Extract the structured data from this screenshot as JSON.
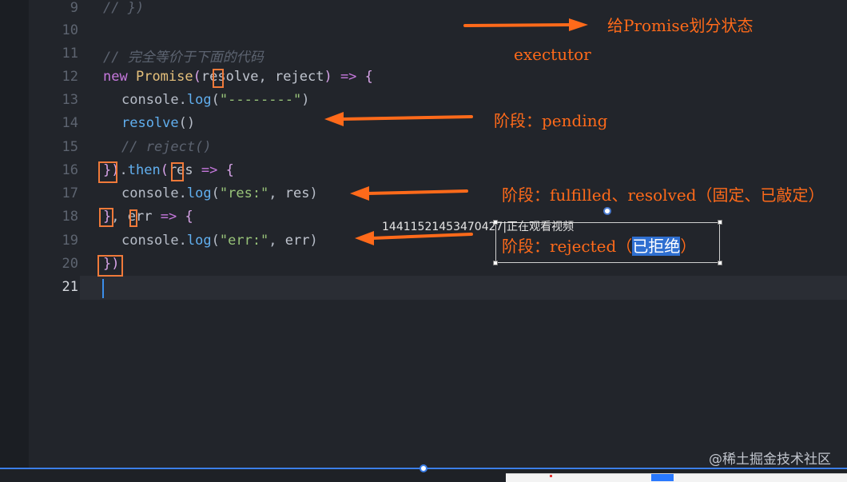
{
  "editor": {
    "line_numbers": [
      "9",
      "10",
      "11",
      "12",
      "13",
      "14",
      "15",
      "16",
      "17",
      "18",
      "19",
      "20",
      "21"
    ],
    "lines": {
      "l9": "// })",
      "l11": "// 完全等价于下面的代码",
      "l12": {
        "kw": "new",
        "cls": "Promise",
        "open": "(",
        "p1": "resolve",
        "comma": ", ",
        "p2": "reject",
        "close": ")",
        "arrow": "=>",
        "brace": "{"
      },
      "l13": {
        "obj": "console",
        "dot": ".",
        "fn": "log",
        "open": "(",
        "str": "\"--------\"",
        "close": ")"
      },
      "l14": {
        "fn": "resolve",
        "parens": "()"
      },
      "l15": "// reject()",
      "l16": {
        "close": "})",
        "dot": ".",
        "fn": "then",
        "open": "(",
        "p": "res",
        "arrow": "=>",
        "brace": "{"
      },
      "l17": {
        "obj": "console",
        "dot": ".",
        "fn": "log",
        "open": "(",
        "str": "\"res:\"",
        "comma": ", ",
        "p": "res",
        "close": ")"
      },
      "l18": {
        "close": "}",
        "comma": ",",
        "p": "err",
        "arrow": "=>",
        "brace": "{"
      },
      "l19": {
        "obj": "console",
        "dot": ".",
        "fn": "log",
        "open": "(",
        "str": "\"err:\"",
        "comma": ", ",
        "p": "err",
        "close": ")"
      },
      "l20": {
        "close": "})"
      }
    }
  },
  "annotations": {
    "state": "给Promise划分状态",
    "executor": "exectutor",
    "pending": "阶段：pending",
    "fulfilled": "阶段：fulfilled、resolved（固定、已敲定）",
    "rejected_prefix": "阶段：rejected（",
    "rejected_selected": "已拒绝",
    "rejected_suffix": "）"
  },
  "viewer_count": "14411521453470427|正在观看视频",
  "watermark": "@稀土掘金技术社区",
  "colors": {
    "accent": "#ff6a1a",
    "keyword": "#c678dd",
    "function": "#61afef",
    "string": "#98c379",
    "class": "#e5c07b",
    "progress": "#3b7ee8"
  },
  "icons": [
    "arrow-right-icon",
    "arrow-left-icon",
    "rotate-handle-icon",
    "scrubber-knob-icon"
  ]
}
